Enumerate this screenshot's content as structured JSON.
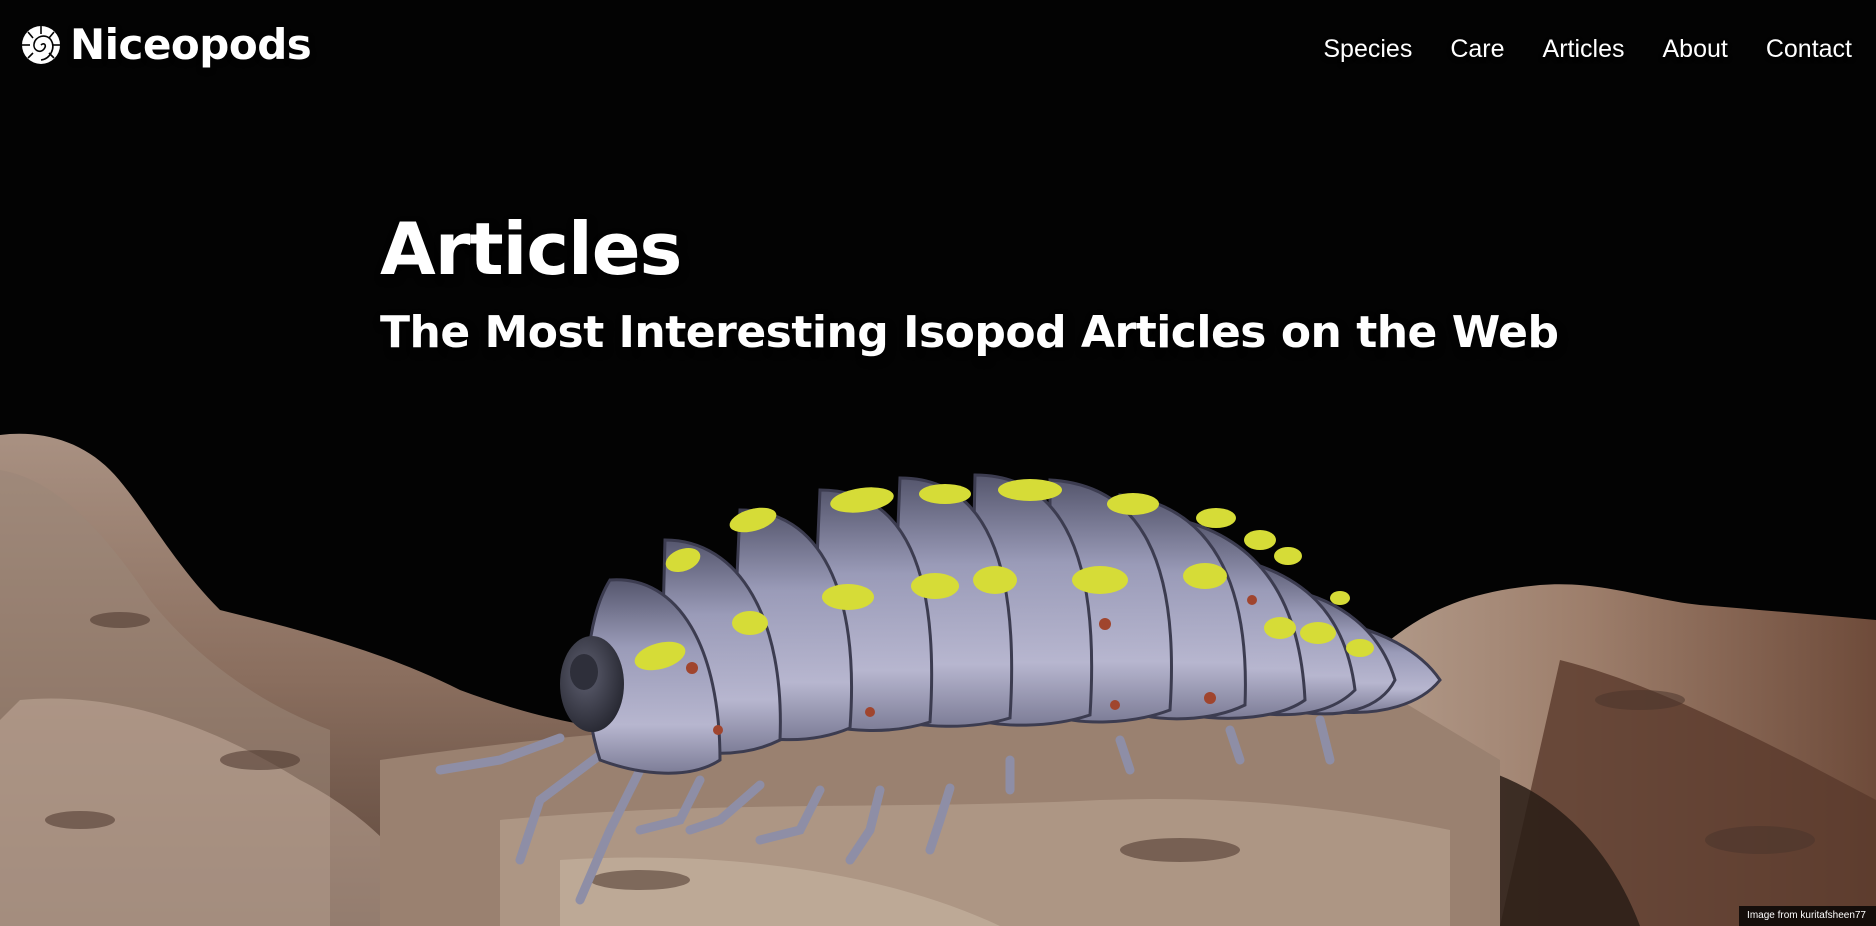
{
  "brand": {
    "name": "Niceopods",
    "icon": "ammonite-shell-icon"
  },
  "nav": {
    "items": [
      {
        "label": "Species"
      },
      {
        "label": "Care"
      },
      {
        "label": "Articles"
      },
      {
        "label": "About"
      },
      {
        "label": "Contact"
      }
    ]
  },
  "hero": {
    "title": "Articles",
    "subtitle": "The Most Interesting Isopod Articles on the Web",
    "image_alt": "isopod-on-bark-photo",
    "credit": "Image from kuritafsheen77"
  },
  "colors": {
    "background": "#030303",
    "text": "#ffffff",
    "isopod_body": "#8f90ad",
    "isopod_spots": "#d6dc37",
    "bark": "#9c7e6c"
  }
}
